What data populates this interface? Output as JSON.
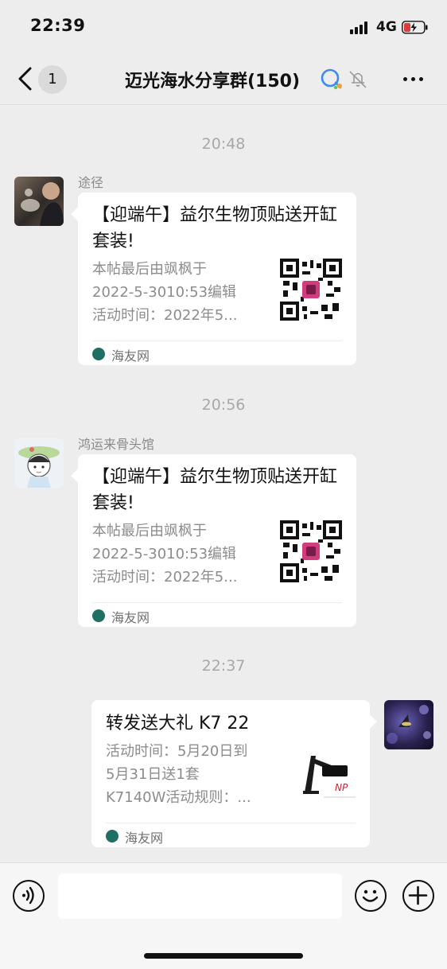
{
  "status_bar": {
    "time": "22:39",
    "network": "4G"
  },
  "nav": {
    "back_count": "1",
    "title": "迈光海水分享群(150)"
  },
  "messages": [
    {
      "timestamp": "20:48",
      "sender": "途径",
      "card": {
        "title": "【迎端午】益尔生物顶贴送开缸套装!",
        "desc_lines": [
          "本帖最后由飒枫于",
          "2022-5-3010:53编辑",
          "活动时间：2022年5..."
        ],
        "source": "海友网"
      }
    },
    {
      "timestamp": "20:56",
      "sender": "鸿运来骨头馆",
      "card": {
        "title": "【迎端午】益尔生物顶贴送开缸套装!",
        "desc_lines": [
          "本帖最后由飒枫于",
          "2022-5-3010:53编辑",
          "活动时间：2022年5..."
        ],
        "source": "海友网"
      }
    },
    {
      "timestamp": "22:37",
      "sender": "",
      "card": {
        "title": "转发送大礼 K7 22",
        "desc_lines": [
          "活动时间：5月20日到",
          "5月31日送1套",
          "K7140W活动规则：..."
        ],
        "source": "海友网",
        "thumb_brand": "NP"
      }
    }
  ],
  "input_bar": {
    "placeholder": ""
  },
  "colors": {
    "background": "#ededed",
    "card": "#ffffff",
    "muted": "#8c8c8c",
    "battery_low": "#e0393e",
    "source_icon": "#1f6f63"
  },
  "icons": [
    "back-icon",
    "mute-bell-icon",
    "more-icon",
    "voice-icon",
    "emoji-icon",
    "plus-icon",
    "qr-code-icon"
  ]
}
